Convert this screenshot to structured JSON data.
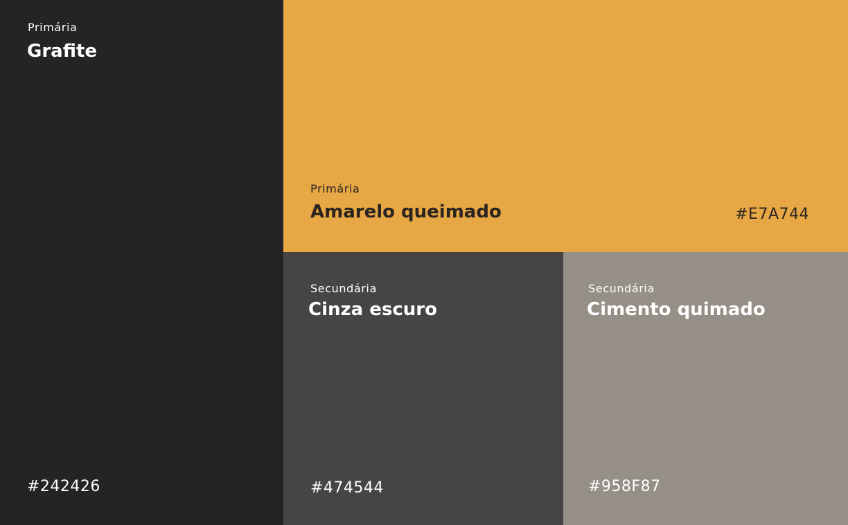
{
  "swatches": {
    "grafite": {
      "role": "Primária",
      "name": "Grafite",
      "hex": "#242426",
      "color": "#242426",
      "text_color": "#ffffff"
    },
    "amarelo": {
      "role": "Primária",
      "name": "Amarelo queimado",
      "hex": "#E7A744",
      "color": "#E7A744",
      "text_color": "#2a2420"
    },
    "cinza": {
      "role": "Secundária",
      "name": "Cinza escuro",
      "hex": "#474544",
      "color": "#474544",
      "text_color": "#ffffff"
    },
    "cimento": {
      "role": "Secundária",
      "name": "Cimento quimado",
      "hex": "#958F87",
      "color": "#958F87",
      "text_color": "#ffffff"
    }
  }
}
